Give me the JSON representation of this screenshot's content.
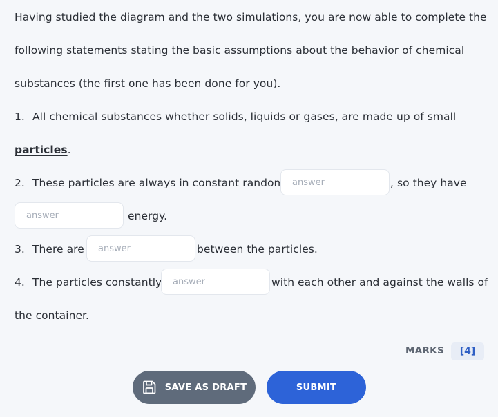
{
  "intro": {
    "line1": "Having studied the diagram and the two simulations, you are now able to complete the",
    "line2": "following statements stating the basic assumptions about the behavior of chemical",
    "line3": "substances (the first one has been done for you)."
  },
  "items": [
    {
      "number": "1.",
      "text_a": "All chemical substances whether solids, liquids or gases, are made up of small",
      "answer_word": "particles",
      "text_b": "."
    },
    {
      "number": "2.",
      "text_a": "These particles are always in constant random",
      "text_b": ", so they have",
      "text_c": "energy."
    },
    {
      "number": "3.",
      "text_a": "There are",
      "text_b": "between the particles."
    },
    {
      "number": "4.",
      "text_a": "The particles constantly",
      "text_b": "with each other and against the walls of",
      "text_c": "the container."
    }
  ],
  "answer_placeholder": "answer",
  "marks": {
    "label": "MARKS",
    "value": "[4]"
  },
  "buttons": {
    "save_draft": "SAVE AS DRAFT",
    "submit": "SUBMIT"
  }
}
